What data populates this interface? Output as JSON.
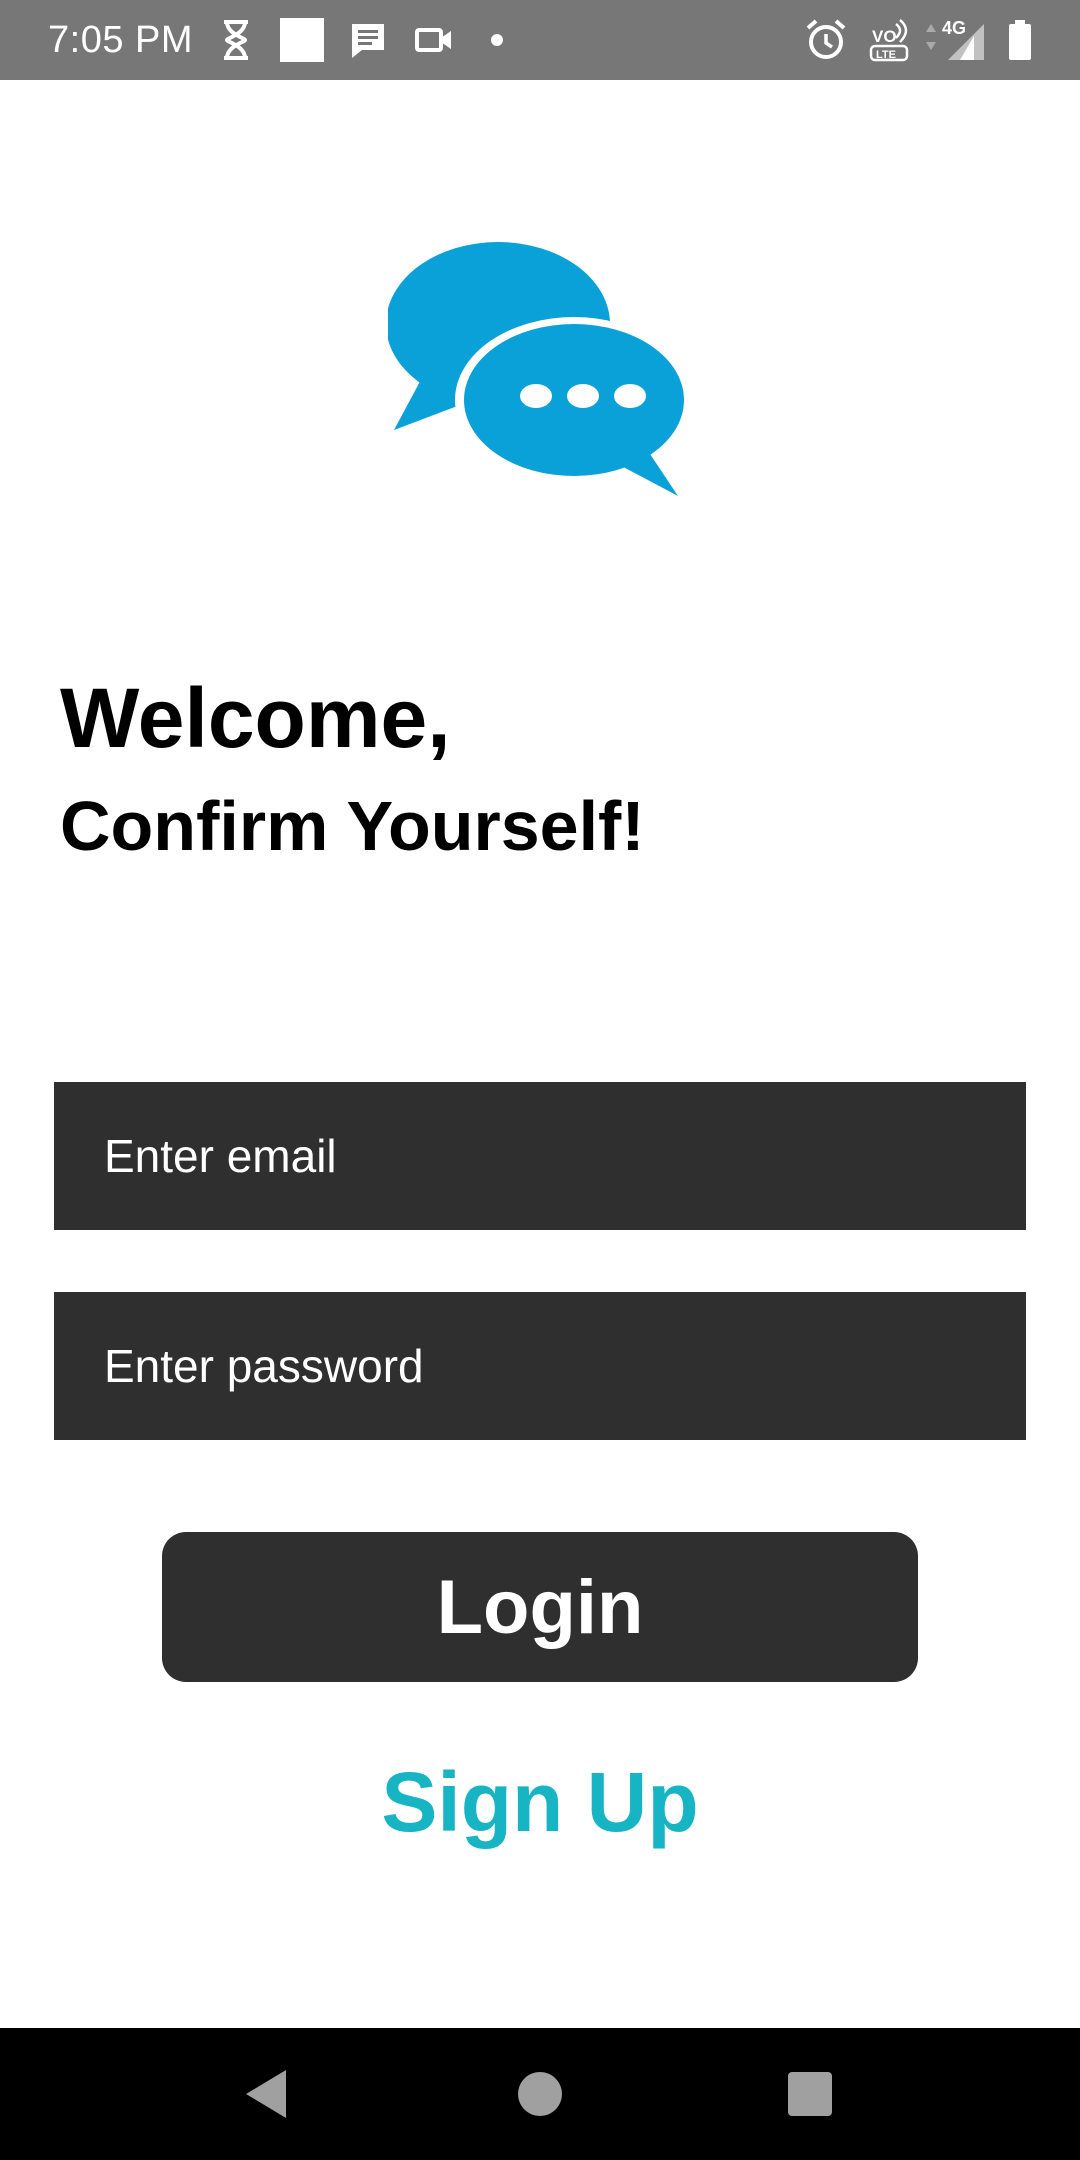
{
  "status_bar": {
    "time": "7:05 PM",
    "icons": [
      "hourglass-icon",
      "white-square-icon",
      "message-icon",
      "video-camera-icon",
      "dot-icon",
      "alarm-icon",
      "volte-icon",
      "signal-4g-icon",
      "battery-icon"
    ],
    "volte_label_top": "VO",
    "volte_label_bottom": "LTE",
    "network_label": "4G"
  },
  "logo": {
    "icon": "chat-bubbles-icon",
    "color": "#0aa0d8"
  },
  "heading": {
    "welcome": "Welcome,",
    "confirm": "Confirm Yourself!"
  },
  "form": {
    "email_placeholder": "Enter email",
    "password_placeholder": "Enter password",
    "login_label": "Login",
    "signup_label": "Sign Up"
  },
  "colors": {
    "status_bar": "#777777",
    "field_background": "#2f2f2f",
    "signup_text": "#17b4c3",
    "nav_bar": "#000000"
  },
  "nav_bar": {
    "buttons": [
      "back-icon",
      "home-icon",
      "recents-icon"
    ]
  }
}
